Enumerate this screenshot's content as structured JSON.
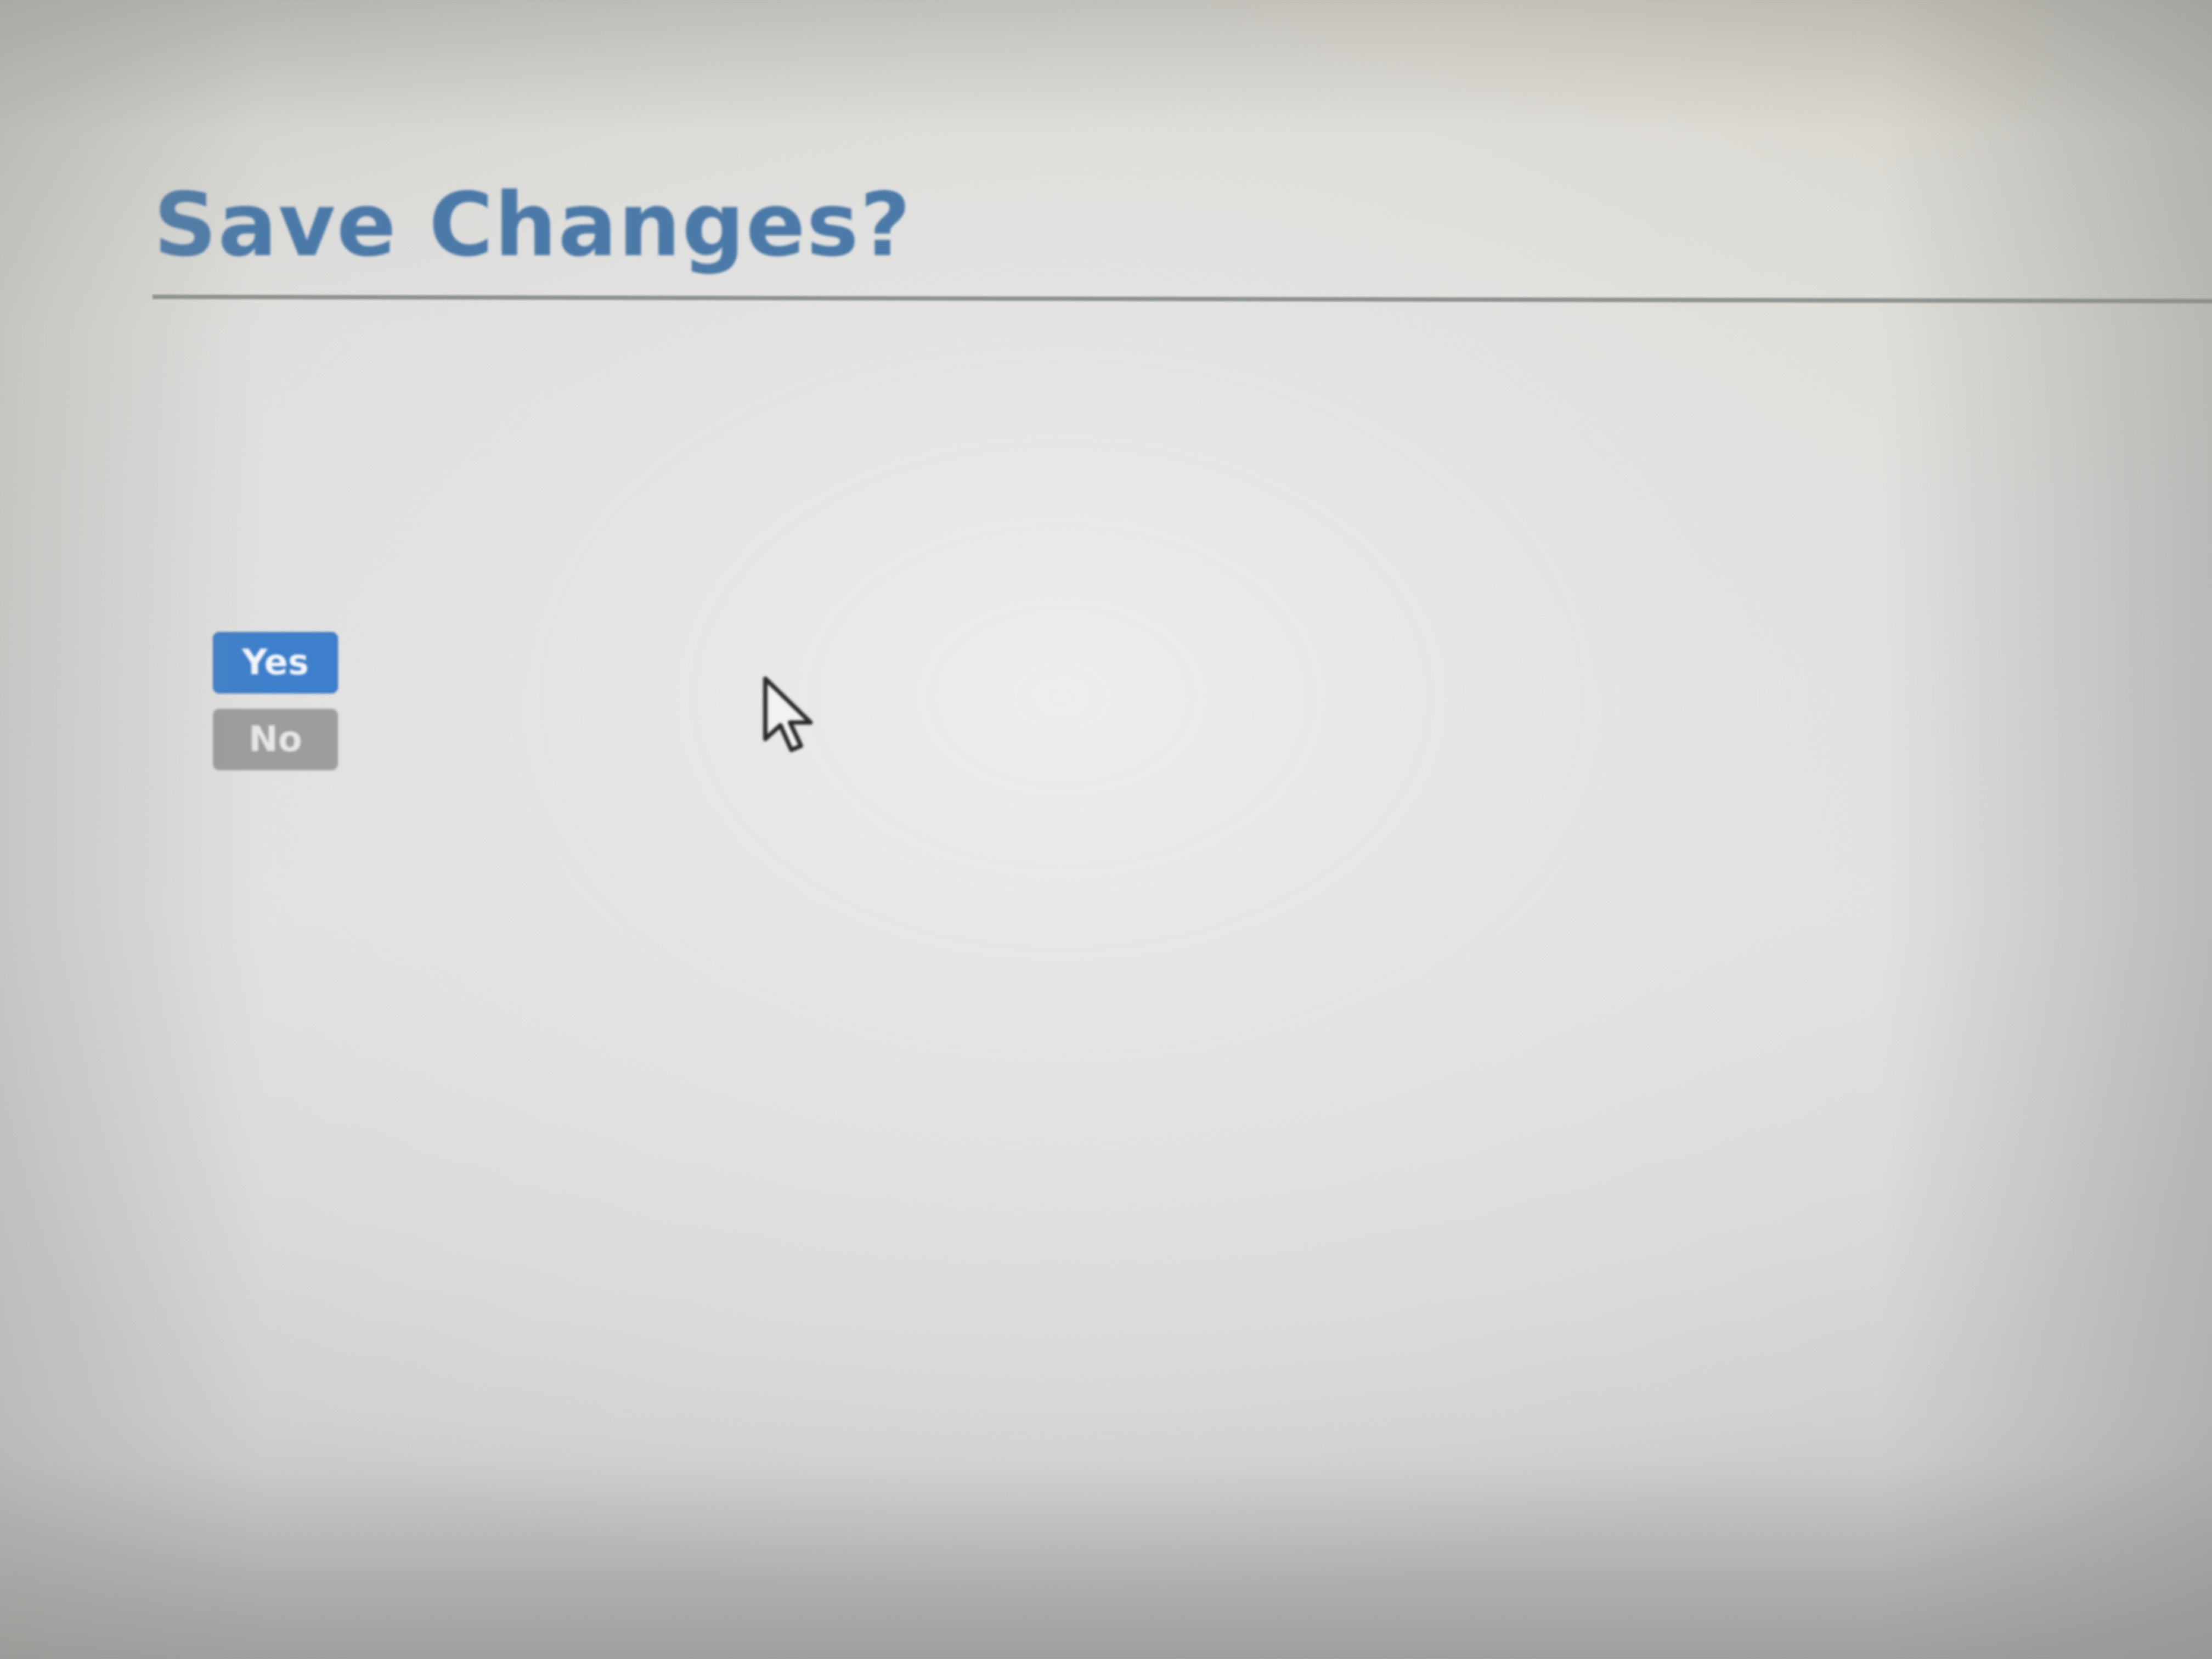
{
  "dialog": {
    "title": "Save Changes?",
    "yes_label": "Yes",
    "no_label": "No"
  },
  "colors": {
    "title": "#4b7aa8",
    "yes_button": "#3d7fcb",
    "no_button": "#9c9d9d",
    "divider": "#8d9391"
  },
  "icons": {
    "cursor": "mouse-pointer-icon"
  }
}
